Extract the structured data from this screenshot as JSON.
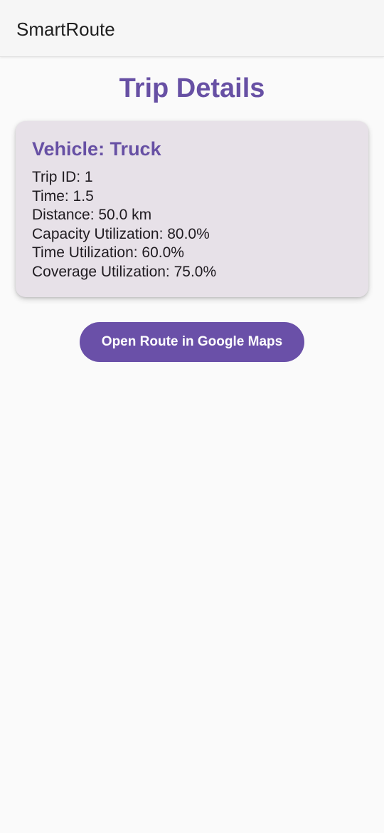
{
  "app_bar": {
    "title": "SmartRoute"
  },
  "page": {
    "title": "Trip Details"
  },
  "trip_card": {
    "heading": "Vehicle: Truck",
    "lines": [
      "Trip ID: 1",
      "Time: 1.5",
      "Distance: 50.0 km",
      "Capacity Utilization: 80.0%",
      "Time Utilization: 60.0%",
      "Coverage Utilization: 75.0%"
    ]
  },
  "actions": {
    "open_route_label": "Open Route in Google Maps"
  },
  "colors": {
    "accent": "#6750a4",
    "card_background": "#e7e1e8",
    "page_background": "#fafafa"
  }
}
